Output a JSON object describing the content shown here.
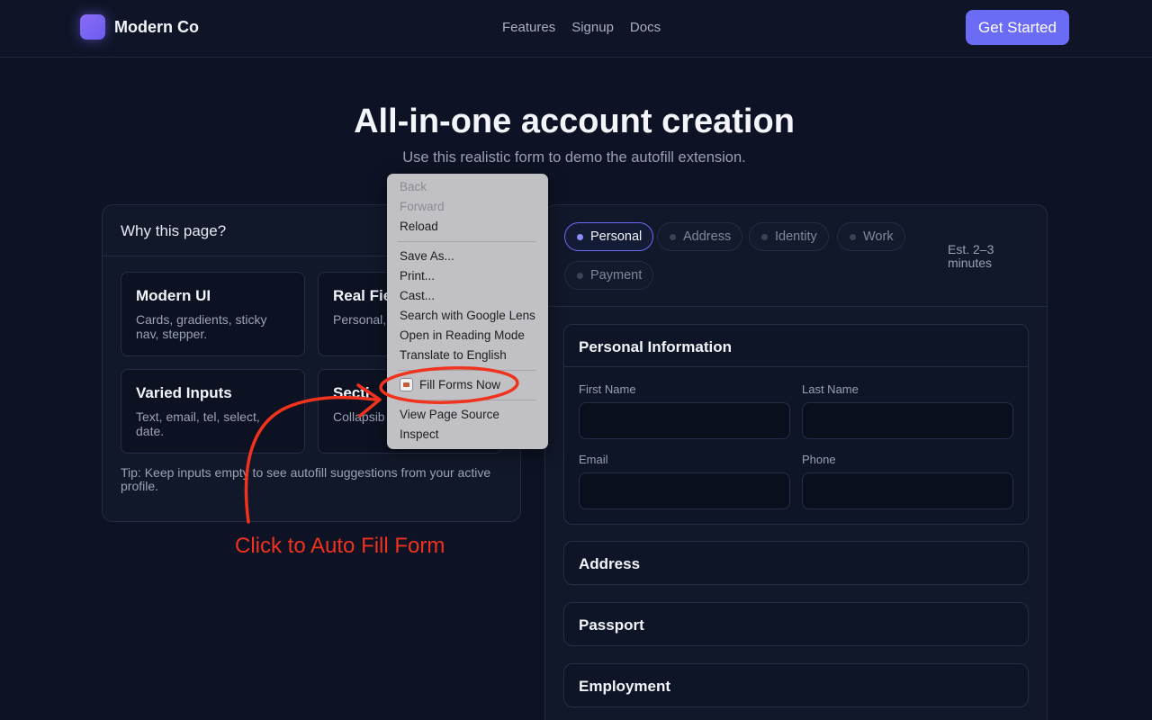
{
  "nav": {
    "brand": "Modern Co",
    "links": [
      "Features",
      "Signup",
      "Docs"
    ],
    "cta": "Get Started"
  },
  "hero": {
    "title": "All-in-one account creation",
    "subtitle": "Use this realistic form to demo the autofill extension."
  },
  "left_card": {
    "title": "Why this page?",
    "features": [
      {
        "title": "Modern UI",
        "desc": "Cards, gradients, sticky nav, stepper."
      },
      {
        "title": "Real Fie",
        "desc": "Personal, passport,"
      },
      {
        "title": "Varied Inputs",
        "desc": "Text, email, tel, select, date."
      },
      {
        "title": "Secti",
        "desc": "Collapsib real apps"
      }
    ],
    "tip": "Tip: Keep inputs empty to see autofill suggestions from your active profile."
  },
  "stepper": {
    "steps": [
      "Personal",
      "Address",
      "Identity",
      "Work",
      "Payment"
    ],
    "active": "Personal",
    "estimate": "Est. 2–3 minutes"
  },
  "personal": {
    "title": "Personal Information",
    "fields": {
      "first_name": {
        "label": "First Name",
        "value": ""
      },
      "last_name": {
        "label": "Last Name",
        "value": ""
      },
      "email": {
        "label": "Email",
        "value": ""
      },
      "phone": {
        "label": "Phone",
        "value": ""
      }
    }
  },
  "sections": [
    "Address",
    "Passport",
    "Employment"
  ],
  "context_menu": {
    "items": [
      {
        "label": "Back",
        "disabled": true
      },
      {
        "label": "Forward",
        "disabled": true
      },
      {
        "label": "Reload",
        "disabled": false
      },
      {
        "label": "Save As...",
        "disabled": false
      },
      {
        "label": "Print...",
        "disabled": false
      },
      {
        "label": "Cast...",
        "disabled": false
      },
      {
        "label": "Search with Google Lens",
        "disabled": false
      },
      {
        "label": "Open in Reading Mode",
        "disabled": false
      },
      {
        "label": "Translate to English",
        "disabled": false
      },
      {
        "label": "Fill Forms Now",
        "disabled": false,
        "icon": "extension-icon"
      },
      {
        "label": "View Page Source",
        "disabled": false
      },
      {
        "label": "Inspect",
        "disabled": false
      }
    ]
  },
  "annotation": {
    "text": "Click to Auto Fill Form",
    "color": "#f0321e"
  },
  "colors": {
    "background": "#0d1324",
    "accent": "#6a6cf6",
    "card": "#111829"
  }
}
